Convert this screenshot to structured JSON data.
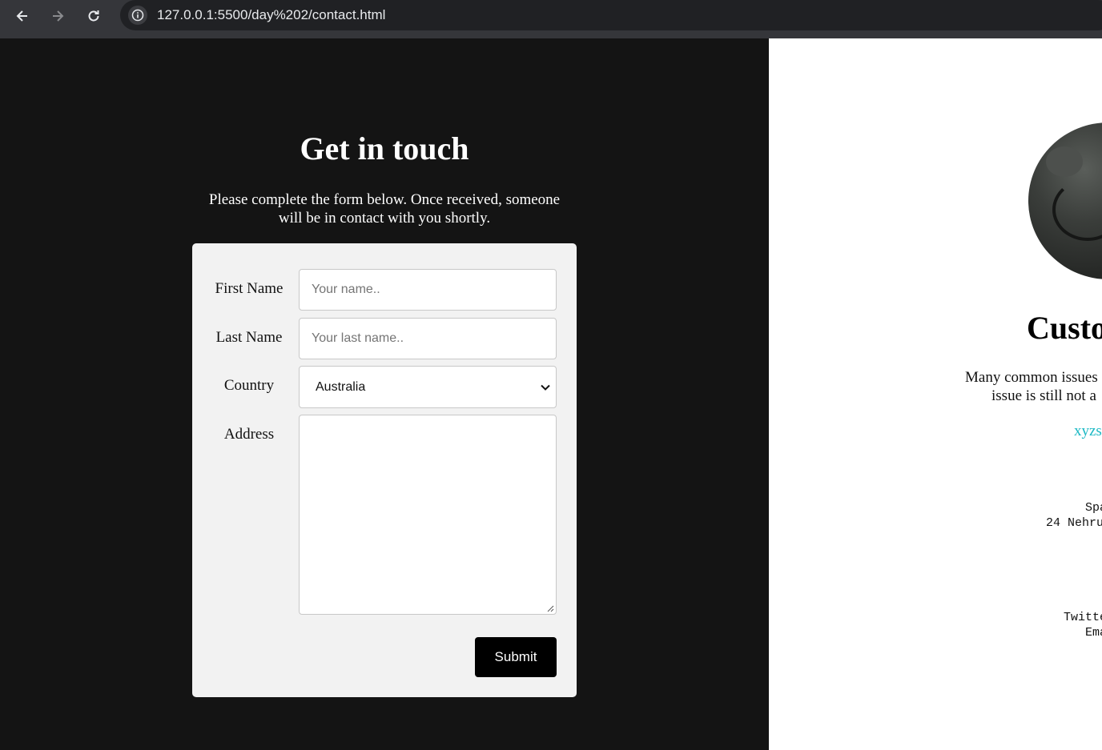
{
  "browser": {
    "url": "127.0.0.1:5500/day%202/contact.html"
  },
  "contact_form": {
    "title": "Get in touch",
    "intro_line1": "Please complete the form below. Once received, someone",
    "intro_line2": "will be in contact with you shortly.",
    "first_name": {
      "label": "First Name",
      "placeholder": "Your name.."
    },
    "last_name": {
      "label": "Last Name",
      "placeholder": "Your last name.."
    },
    "country": {
      "label": "Country",
      "selected": "Australia"
    },
    "address": {
      "label": "Address",
      "value": ""
    },
    "submit_label": "Submit"
  },
  "support_panel": {
    "title": "Custo",
    "text_line1": "Many common issues",
    "text_line2": "issue is still not a",
    "link": "xyzs",
    "address_line1": "Spa",
    "address_line2": "24 Nehru",
    "social_line1": "Twitte",
    "social_line2": "Ema"
  },
  "colors": {
    "chrome": "#35363a",
    "left_panel": "#141414",
    "card": "#f2f2f2",
    "submit": "#000000",
    "link": "#19b8c4"
  }
}
